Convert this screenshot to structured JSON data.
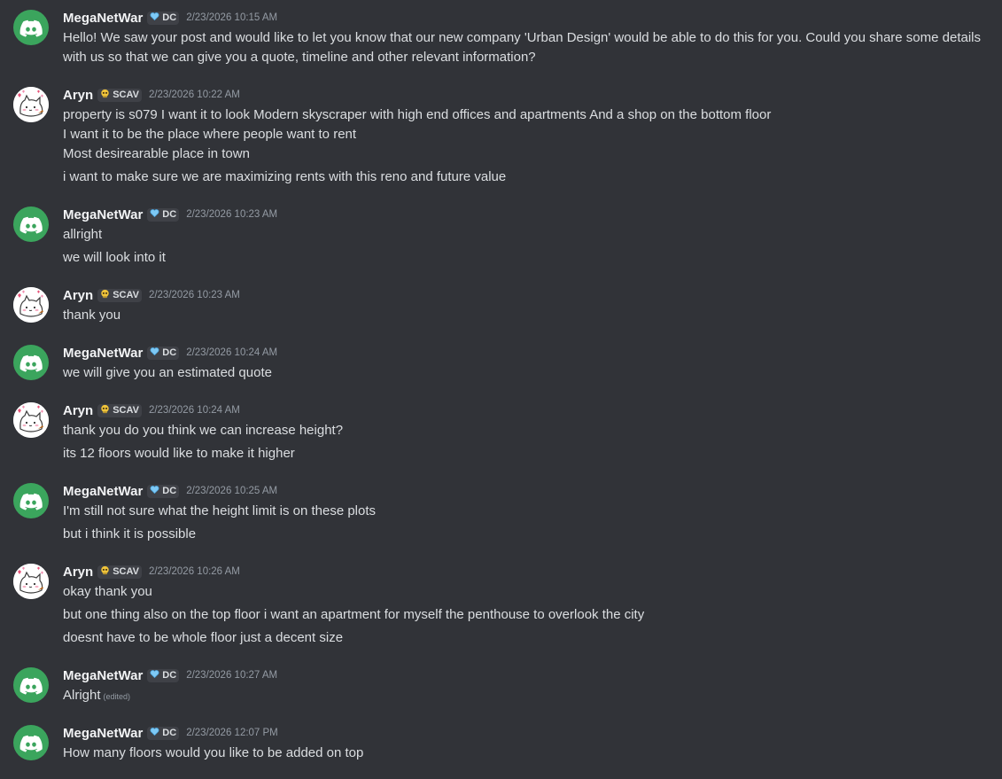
{
  "users": {
    "meganetwar": {
      "name": "MegaNetWar",
      "tag": "DC",
      "tag_icon": "blue-heart-icon",
      "avatar_icon": "discord-logo-icon",
      "avatar_color": "#3ba55d"
    },
    "aryn": {
      "name": "Aryn",
      "tag": "SCAV",
      "tag_icon": "skull-icon",
      "avatar_icon": "cat-with-hearts-icon"
    }
  },
  "messages": [
    {
      "author": "MegaNetWar",
      "tag": "DC",
      "timestamp": "2/23/2026 10:15 AM",
      "lines": [
        "Hello! We saw your post and would like to let you know that our new company 'Urban Design' would be able to do this for you. Could you share some details with us so that we can give you a quote, timeline and other relevant information?"
      ]
    },
    {
      "author": "Aryn",
      "tag": "SCAV",
      "timestamp": "2/23/2026 10:22 AM",
      "lines": [
        "property is s079 I want it to look Modern skyscraper with high end offices and apartments And a shop on the bottom floor",
        "I want it to be the place where  people want to rent",
        "Most desirearable place in town",
        "i want to make sure we are maximizing rents with this reno and future value"
      ]
    },
    {
      "author": "MegaNetWar",
      "tag": "DC",
      "timestamp": "2/23/2026 10:23 AM",
      "lines": [
        "allright",
        "we will look into it"
      ]
    },
    {
      "author": "Aryn",
      "tag": "SCAV",
      "timestamp": "2/23/2026 10:23 AM",
      "lines": [
        "thank you"
      ]
    },
    {
      "author": "MegaNetWar",
      "tag": "DC",
      "timestamp": "2/23/2026 10:24 AM",
      "lines": [
        "we will give you an estimated quote"
      ]
    },
    {
      "author": "Aryn",
      "tag": "SCAV",
      "timestamp": "2/23/2026 10:24 AM",
      "lines": [
        "thank you do you think we can increase height?",
        "its 12 floors would like to make it higher"
      ]
    },
    {
      "author": "MegaNetWar",
      "tag": "DC",
      "timestamp": "2/23/2026 10:25 AM",
      "lines": [
        "I'm still not sure what the height limit is on these plots",
        "but i think it is possible"
      ]
    },
    {
      "author": "Aryn",
      "tag": "SCAV",
      "timestamp": "2/23/2026 10:26 AM",
      "lines": [
        "okay thank you",
        "but one thing also on the top floor i want an apartment for myself the penthouse to overlook the city",
        "doesnt have to be whole floor just a decent size"
      ]
    },
    {
      "author": "MegaNetWar",
      "tag": "DC",
      "timestamp": "2/23/2026 10:27 AM",
      "lines": [
        "Alright"
      ],
      "edited_label": "(edited)"
    },
    {
      "author": "MegaNetWar",
      "tag": "DC",
      "timestamp": "2/23/2026 12:07 PM",
      "lines": [
        "How many floors would you like to be added on top"
      ]
    }
  ]
}
